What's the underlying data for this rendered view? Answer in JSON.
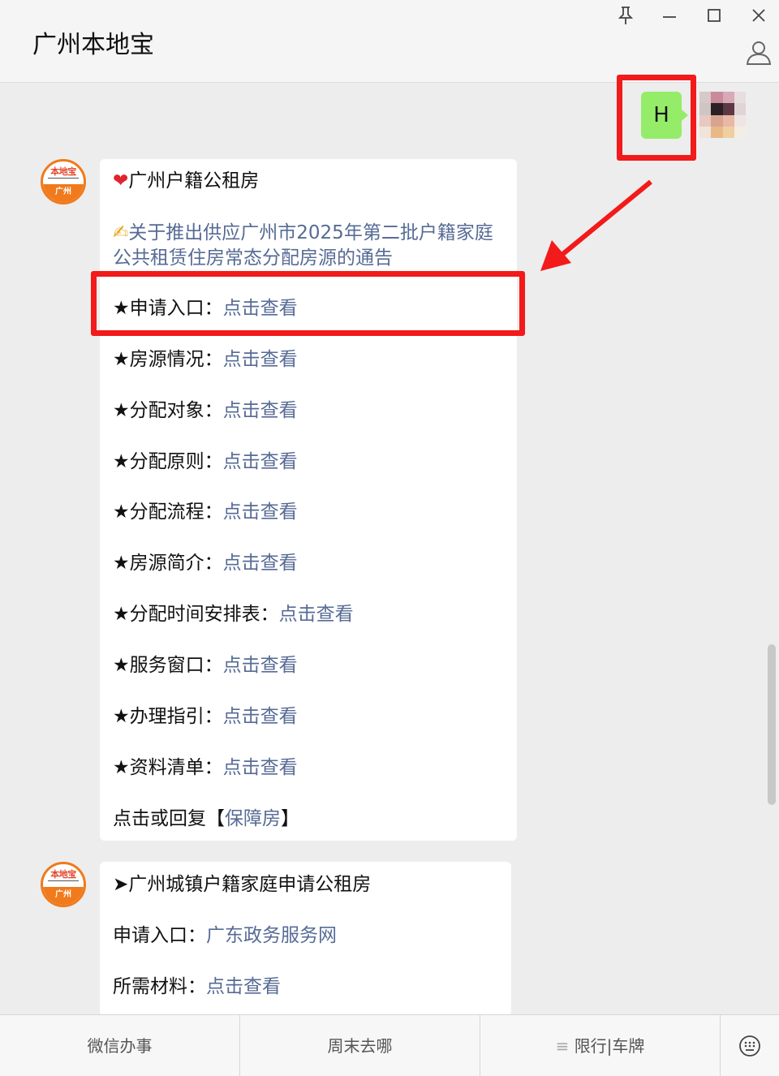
{
  "window": {
    "title": "广州本地宝",
    "pin_glyph": "⚲",
    "minimize_glyph": "—",
    "maximize_glyph": "☐",
    "close_glyph": "✕"
  },
  "sent_message": {
    "text": "H"
  },
  "highlight_color": "#f21a1a",
  "bot": {
    "avatar_top": "本地宝",
    "avatar_bottom": "广州"
  },
  "card1": {
    "title": "广州户籍公租房",
    "notice_icon": "✍",
    "notice_line1": "关于推出供应广州市2025年第二批户籍家庭",
    "notice_line2": "公共租赁住房常态分配房源的通告",
    "items": [
      {
        "label": "★申请入口：",
        "link": "点击查看"
      },
      {
        "label": "★房源情况：",
        "link": "点击查看"
      },
      {
        "label": "★分配对象：",
        "link": "点击查看"
      },
      {
        "label": "★分配原则：",
        "link": "点击查看"
      },
      {
        "label": "★分配流程：",
        "link": "点击查看"
      },
      {
        "label": "★房源简介：",
        "link": "点击查看"
      },
      {
        "label": "★分配时间安排表：",
        "link": "点击查看"
      },
      {
        "label": "★服务窗口：",
        "link": "点击查看"
      },
      {
        "label": "★办理指引：",
        "link": "点击查看"
      },
      {
        "label": "★资料清单：",
        "link": "点击查看"
      }
    ],
    "reply_prefix": "点击或回复【",
    "reply_link": "保障房",
    "reply_suffix": "】"
  },
  "card2": {
    "title": "➤广州城镇户籍家庭申请公租房",
    "apply_label": "申请入口：",
    "apply_link": "广东政务服务网",
    "materials_label": "所需材料：",
    "materials_link": "点击查看"
  },
  "bottom_menu": {
    "item1": "微信办事",
    "item2": "周末去哪",
    "item3_icon": "≡",
    "item3": "限行|车牌"
  }
}
